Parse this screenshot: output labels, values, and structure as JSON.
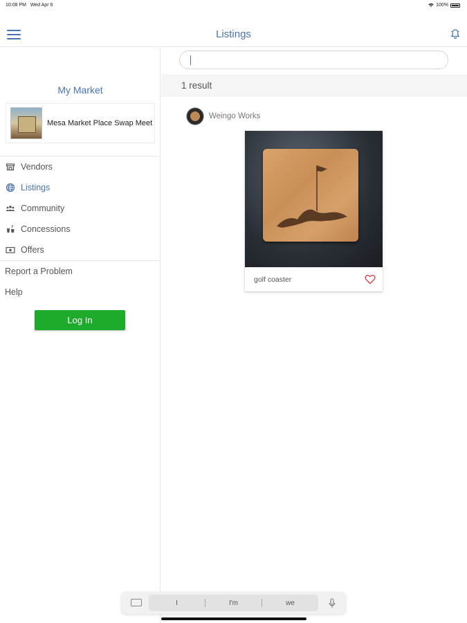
{
  "status_bar": {
    "time": "10:08 PM",
    "date": "Wed Apr 6",
    "battery": "100%"
  },
  "nav": {
    "title": "Listings"
  },
  "sidebar": {
    "heading": "My Market",
    "market_name": "Mesa Market Place Swap Meet",
    "items": [
      {
        "label": "Vendors",
        "icon": "storefront-icon"
      },
      {
        "label": "Listings",
        "icon": "globe-icon",
        "active": true
      },
      {
        "label": "Community",
        "icon": "people-icon"
      },
      {
        "label": "Concessions",
        "icon": "food-icon"
      },
      {
        "label": "Offers",
        "icon": "ticket-icon"
      }
    ],
    "report_problem": "Report a Problem",
    "help": "Help",
    "login": "Log In"
  },
  "main": {
    "search": {
      "value": "",
      "placeholder": ""
    },
    "result_count": "1 result",
    "listings": [
      {
        "vendor": "Weingo Works",
        "title": "golf coaster",
        "favorited": false
      }
    ]
  },
  "keyboard": {
    "suggestions": [
      "I",
      "I'm",
      "we"
    ]
  },
  "colors": {
    "accent": "#4a72b8",
    "login_green": "#1eaa2b",
    "heart_red": "#d9434f"
  }
}
